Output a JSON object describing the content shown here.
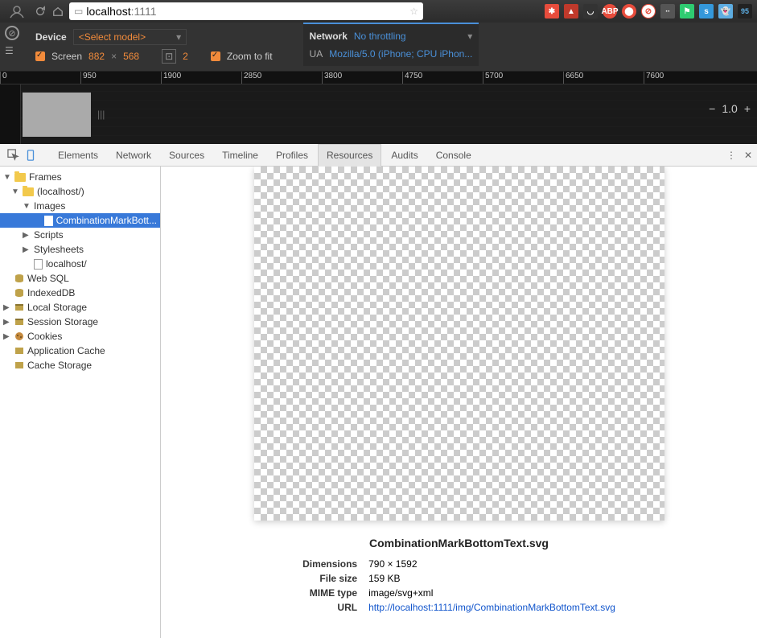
{
  "browser": {
    "url_host": "localhost",
    "url_port": ":1111"
  },
  "device": {
    "label": "Device",
    "select_model": "<Select model>",
    "screen_label": "Screen",
    "width": "882",
    "height": "568",
    "dpr": "2",
    "zoom_label": "Zoom to fit",
    "network_label": "Network",
    "throttling": "No throttling",
    "ua_label": "UA",
    "ua_value": "Mozilla/5.0 (iPhone; CPU iPhon...",
    "zoom_value": "1.0"
  },
  "ruler": {
    "ticks": [
      "0",
      "950",
      "1900",
      "2850",
      "3800",
      "4750",
      "5700",
      "6650",
      "7600"
    ]
  },
  "tabs": {
    "elements": "Elements",
    "network": "Network",
    "sources": "Sources",
    "timeline": "Timeline",
    "profiles": "Profiles",
    "resources": "Resources",
    "audits": "Audits",
    "console": "Console"
  },
  "tree": {
    "frames": "Frames",
    "localhost": "(localhost/)",
    "images": "Images",
    "selected": "CombinationMarkBott...",
    "scripts": "Scripts",
    "stylesheets": "Stylesheets",
    "root_doc": "localhost/",
    "websql": "Web SQL",
    "indexeddb": "IndexedDB",
    "localstorage": "Local Storage",
    "sessionstorage": "Session Storage",
    "cookies": "Cookies",
    "appcache": "Application Cache",
    "cachestorage": "Cache Storage"
  },
  "resource": {
    "filename": "CombinationMarkBottomText.svg",
    "dim_label": "Dimensions",
    "dim_value": "790 × 1592",
    "size_label": "File size",
    "size_value": "159 KB",
    "mime_label": "MIME type",
    "mime_value": "image/svg+xml",
    "url_label": "URL",
    "url_value": "http://localhost:1111/img/CombinationMarkBottomText.svg"
  }
}
